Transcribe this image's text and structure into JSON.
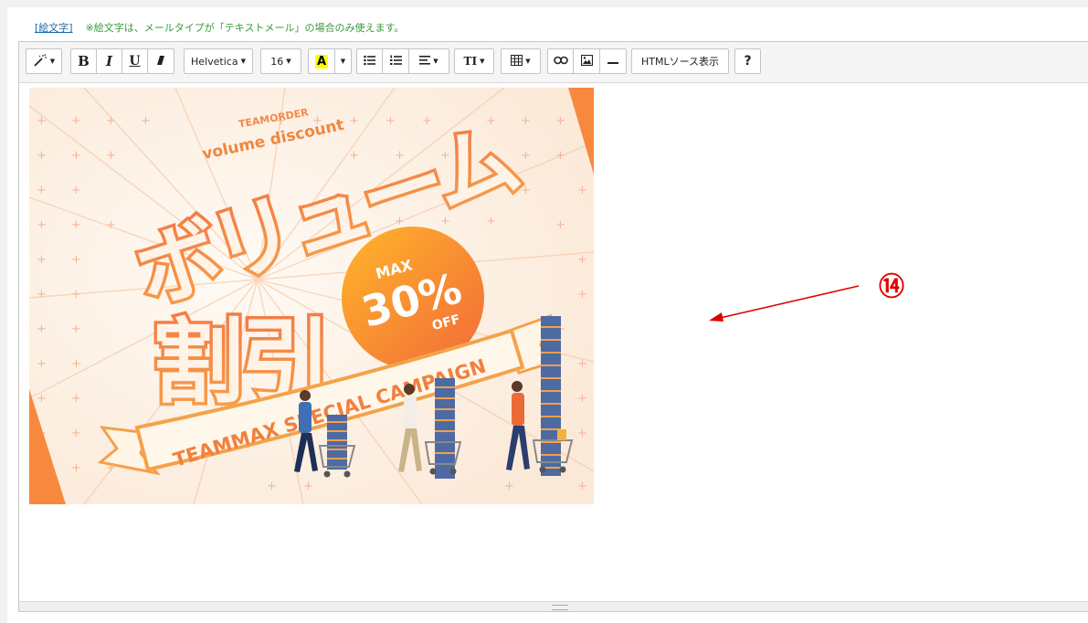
{
  "hint": {
    "emoji_link": "[絵文字]",
    "note": "※絵文字は、メールタイプが「テキストメール」の場合のみ使えます。"
  },
  "toolbar": {
    "font_family": "Helvetica",
    "font_size": "16",
    "highlight_label": "A",
    "html_source_label": "HTMLソース表示",
    "help_label": "?",
    "bold_label": "B",
    "italic_label": "I",
    "underline_label": "U",
    "text_size_label": "TI"
  },
  "banner": {
    "top_brand": "TEAMORDER",
    "script_text": "volume discount",
    "title_line1": "ボリューム",
    "title_line2": "割引",
    "badge_max": "MAX",
    "badge_value": "30%",
    "badge_off": "OFF",
    "ribbon_text": "TEAMMAX SPECIAL CAMPAIGN"
  },
  "annotation": {
    "number": "⑭",
    "color": "#e00000"
  },
  "colors": {
    "accent_orange": "#f07a3a",
    "banner_bg": "#fdf1e6",
    "hint_green": "#3a9a3a",
    "link_blue": "#1a6aa8"
  }
}
